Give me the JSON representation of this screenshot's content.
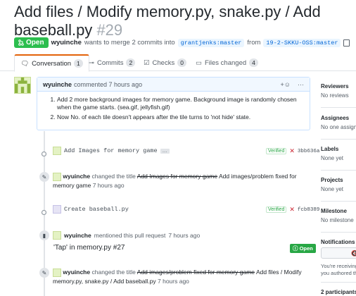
{
  "pr": {
    "title": "Add files / Modify memory.py, snake.py / Add baseball.py",
    "number": "#29",
    "state": "Open",
    "author": "wyuinche",
    "meta_text_1": "wants to merge 2 commits into",
    "base_branch": "grantjenks:master",
    "from_text": "from",
    "head_branch": "19-2-SKKU-OSS:master"
  },
  "tabs": [
    {
      "label": "Conversation",
      "count": "1"
    },
    {
      "label": "Commits",
      "count": "2"
    },
    {
      "label": "Checks",
      "count": "0"
    },
    {
      "label": "Files changed",
      "count": "4"
    }
  ],
  "comment": {
    "author": "wyuinche",
    "action": "commented 7 hours ago",
    "items": [
      "Add 2 more background images for memory game. Background image is randomly chosen when the game starts. (sea.gif, jellyfish.gif)",
      "Now No. of each tile doesn't appears after the tile turns to 'not hide' state."
    ]
  },
  "timeline": {
    "commit1": {
      "message": "Add Images for memory game",
      "more": "…",
      "verified": "Verified",
      "sha": "3bb636a"
    },
    "rename1": {
      "author": "wyuinche",
      "action": "changed the title",
      "old": "Add Images for memory game",
      "new": "Add images/problem fixed for memory game",
      "time": "7 hours ago"
    },
    "commit2": {
      "message": "Create baseball.py",
      "verified": "Verified",
      "sha": "fcb8389"
    },
    "mention": {
      "author": "wyuinche",
      "action": "mentioned this pull request",
      "time": "7 hours ago",
      "ref_title": "'Tap' in memory.py #27",
      "ref_state": "Open"
    },
    "rename2": {
      "author": "wyuinche",
      "action": "changed the title",
      "old": "Add images/problem fixed for memory game",
      "new": "Add files / Modify memory.py, snake.py / Add baseball.py",
      "time": "7 hours ago"
    }
  },
  "sidebar": {
    "reviewers": {
      "heading": "Reviewers",
      "value": "No reviews"
    },
    "assignees": {
      "heading": "Assignees",
      "value": "No one assigned"
    },
    "labels": {
      "heading": "Labels",
      "value": "None yet"
    },
    "projects": {
      "heading": "Projects",
      "value": "None yet"
    },
    "milestone": {
      "heading": "Milestone",
      "value": "No milestone"
    },
    "notifications": {
      "heading": "Notifications",
      "line1": "You're receiving",
      "line2": "you authored the"
    },
    "participants": "2 participants"
  },
  "colors": {
    "open_green": "#2cbe4e",
    "accent_orange": "#e36209",
    "link_blue": "#0366d6"
  }
}
